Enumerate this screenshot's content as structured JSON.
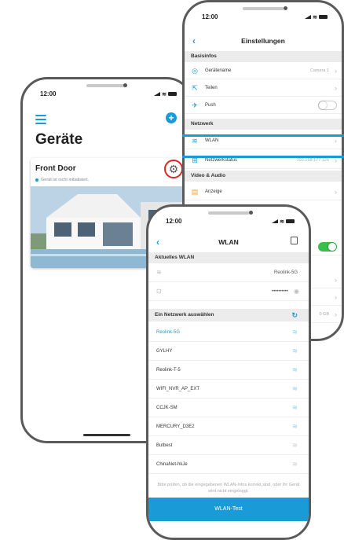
{
  "phone_a": {
    "time": "12:00",
    "title": "Geräte",
    "device": {
      "name": "Front Door",
      "status": "Gerät ist nicht initialisiert."
    }
  },
  "phone_b": {
    "time": "12:00",
    "title": "Einstellungen",
    "sections": {
      "basisinfos": "Basisinfos",
      "netzwerk": "Netzwerk",
      "video_audio": "Video & Audio"
    },
    "rows": {
      "geraetename": {
        "label": "Gerätename",
        "value": "Camera 1"
      },
      "teilen": {
        "label": "Teilen"
      },
      "push": {
        "label": "Push",
        "on": false
      },
      "wlan": {
        "label": "WLAN"
      },
      "netzwerkstatus": {
        "label": "Netzwerkstatus",
        "value": "192.168.177.126"
      },
      "anzeige": {
        "label": "Anzeige"
      }
    },
    "peek_value": "0 GB"
  },
  "phone_c": {
    "time": "12:00",
    "title": "WLAN",
    "aktuelles_wlan": "Aktuelles WLAN",
    "current_ssid": "Reolink-5G",
    "current_password": "••••••••••",
    "choose_network": "Ein Netzwerk auswählen",
    "networks": [
      "Reolink-5G",
      "GYLHY",
      "Reolink-T-5",
      "WIFI_NVR_AP_EXT",
      "CCJK-SM",
      "MERCURY_D3E2",
      "Butbest",
      "ChinaNet-hkJe"
    ],
    "note": "Bitte prüfen, ob die eingegebenen WLAN-Infos korrekt sind, oder Ihr Gerät wird nicht eingeloggt.",
    "test_button": "WLAN-Test"
  },
  "colors": {
    "accent": "#1a9bd7",
    "highlight_ring": "#e32323",
    "toggle_on": "#3bbd4a"
  }
}
